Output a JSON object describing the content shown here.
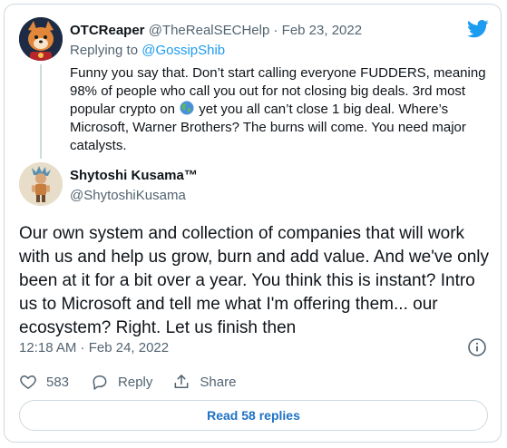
{
  "reply_tweet": {
    "author_name": "OTCReaper",
    "author_handle": "@TheRealSECHelp",
    "separator": "·",
    "date": "Feb 23, 2022",
    "replying_prefix": "Replying to",
    "replying_to": "@GossipShib",
    "text_before_emoji": "Funny you say that. Don’t start calling everyone FUDDERS, meaning 98% of people who call you out for not closing big deals. 3rd most popular crypto on",
    "emoji": "globe-emoji",
    "text_after_emoji": "yet you all can’t close 1 big deal. Where’s Microsoft, Warner Brothers? The burns will come. You need major catalysts."
  },
  "main_tweet": {
    "author_name": "Shytoshi Kusama™",
    "author_handle": "@ShytoshiKusama",
    "text": "Our own system and collection of companies that will work with us and help us grow, burn and add value. And we've only been at it for a bit over a year. You think this is instant? Intro us to Microsoft and tell me what I'm offering them... our ecosystem? Right. Let us finish then",
    "timestamp": "12:18 AM · Feb 24, 2022"
  },
  "actions": {
    "like_count": "583",
    "reply_label": "Reply",
    "share_label": "Share"
  },
  "read_replies_label": "Read 58 replies",
  "icons": {
    "brand": "twitter-bird-icon",
    "info": "info-icon",
    "like": "heart-icon",
    "reply": "comment-icon",
    "share": "share-icon"
  },
  "colors": {
    "accent": "#1d9bf0",
    "secondary_text": "#536471",
    "border": "#cfd9de"
  }
}
